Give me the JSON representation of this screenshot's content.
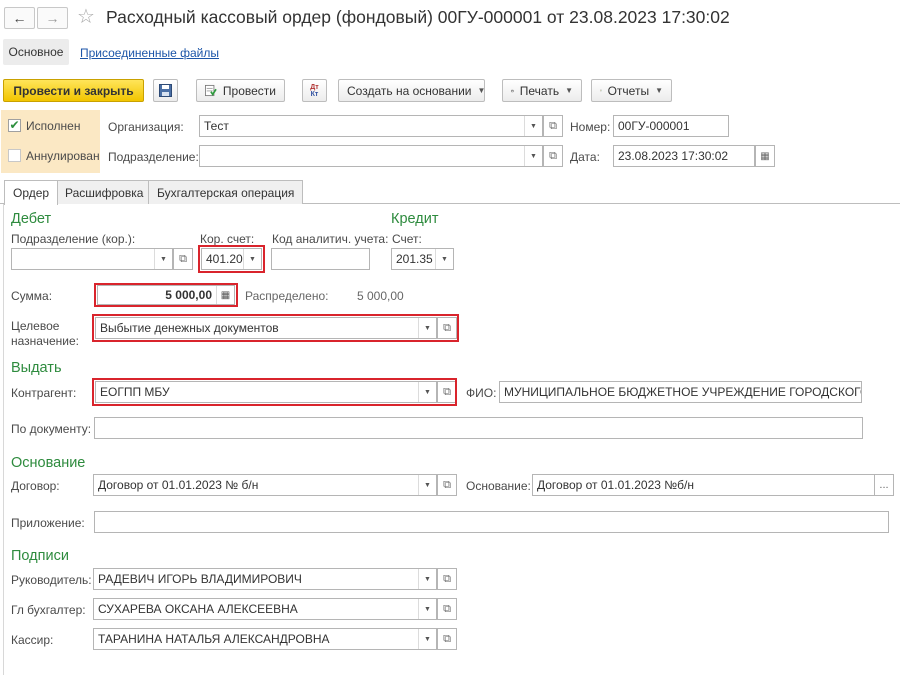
{
  "window": {
    "title": "Расходный кассовый ордер (фондовый) 00ГУ-000001 от 23.08.2023 17:30:02"
  },
  "nav": {
    "back_icon": "arrow-left-icon",
    "forward_icon": "arrow-right-icon",
    "favorite_icon": "star-icon",
    "sections": [
      "Основное",
      "Присоединенные файлы"
    ]
  },
  "toolbar": {
    "post_close": "Провести и закрыть",
    "save_icon": "save-icon",
    "post": "Провести",
    "dtkt_icon": "dt-kt-icon",
    "create_based": "Создать на основании",
    "print": "Печать",
    "reports": "Отчеты"
  },
  "status": {
    "executed_label": "Исполнен",
    "executed_checked": true,
    "cancelled_label": "Аннулирован",
    "cancelled_checked": false
  },
  "header": {
    "org_label": "Организация:",
    "org_value": "Тест",
    "subdiv_label": "Подразделение:",
    "subdiv_value": "",
    "number_label": "Номер:",
    "number_value": "00ГУ-000001",
    "date_label": "Дата:",
    "date_value": "23.08.2023 17:30:02"
  },
  "tabs": [
    "Ордер",
    "Расшифровка",
    "Бухгалтерская операция"
  ],
  "debit": {
    "title": "Дебет",
    "subdiv_label": "Подразделение (кор.):",
    "subdiv_value": "",
    "kor_account_label": "Кор. счет:",
    "kor_account_value": "401.20",
    "analytic_label": "Код аналитич. учета:",
    "analytic_value": ""
  },
  "credit": {
    "title": "Кредит",
    "account_label": "Счет:",
    "account_value": "201.35"
  },
  "sum": {
    "label": "Сумма:",
    "value": "5 000,00",
    "distributed_label": "Распределено:",
    "distributed_value": "5 000,00"
  },
  "purpose": {
    "label_line1": "Целевое",
    "label_line2": "назначение:",
    "value": "Выбытие денежных документов"
  },
  "issue": {
    "title": "Выдать",
    "counterparty_label": "Контрагент:",
    "counterparty_value": "ЕОГПП МБУ",
    "fio_label": "ФИО:",
    "fio_value": "МУНИЦИПАЛЬНОЕ БЮДЖЕТНОЕ УЧРЕЖДЕНИЕ ГОРОДСКОГО С",
    "doc_label": "По документу:",
    "doc_value": ""
  },
  "basis": {
    "title": "Основание",
    "contract_label": "Договор:",
    "contract_value": "Договор от 01.01.2023 № б/н",
    "basis_label": "Основание:",
    "basis_value": "Договор от 01.01.2023 №б/н",
    "attachment_label": "Приложение:",
    "attachment_value": ""
  },
  "signatures": {
    "title": "Подписи",
    "head_label": "Руководитель:",
    "head_value": "РАДЕВИЧ ИГОРЬ ВЛАДИМИРОВИЧ",
    "accountant_label": "Гл бухгалтер:",
    "accountant_value": "СУХАРЕВА ОКСАНА АЛЕКСЕЕВНА",
    "cashier_label": "Кассир:",
    "cashier_value": "ТАРАНИНА НАТАЛЬЯ АЛЕКСАНДРОВНА"
  },
  "colors": {
    "accent_green": "#2e8b3e",
    "primary_button": "#f2c500",
    "highlight_red": "#d9242c",
    "status_panel": "#fbe8c4",
    "link_blue": "#1c55a8"
  }
}
